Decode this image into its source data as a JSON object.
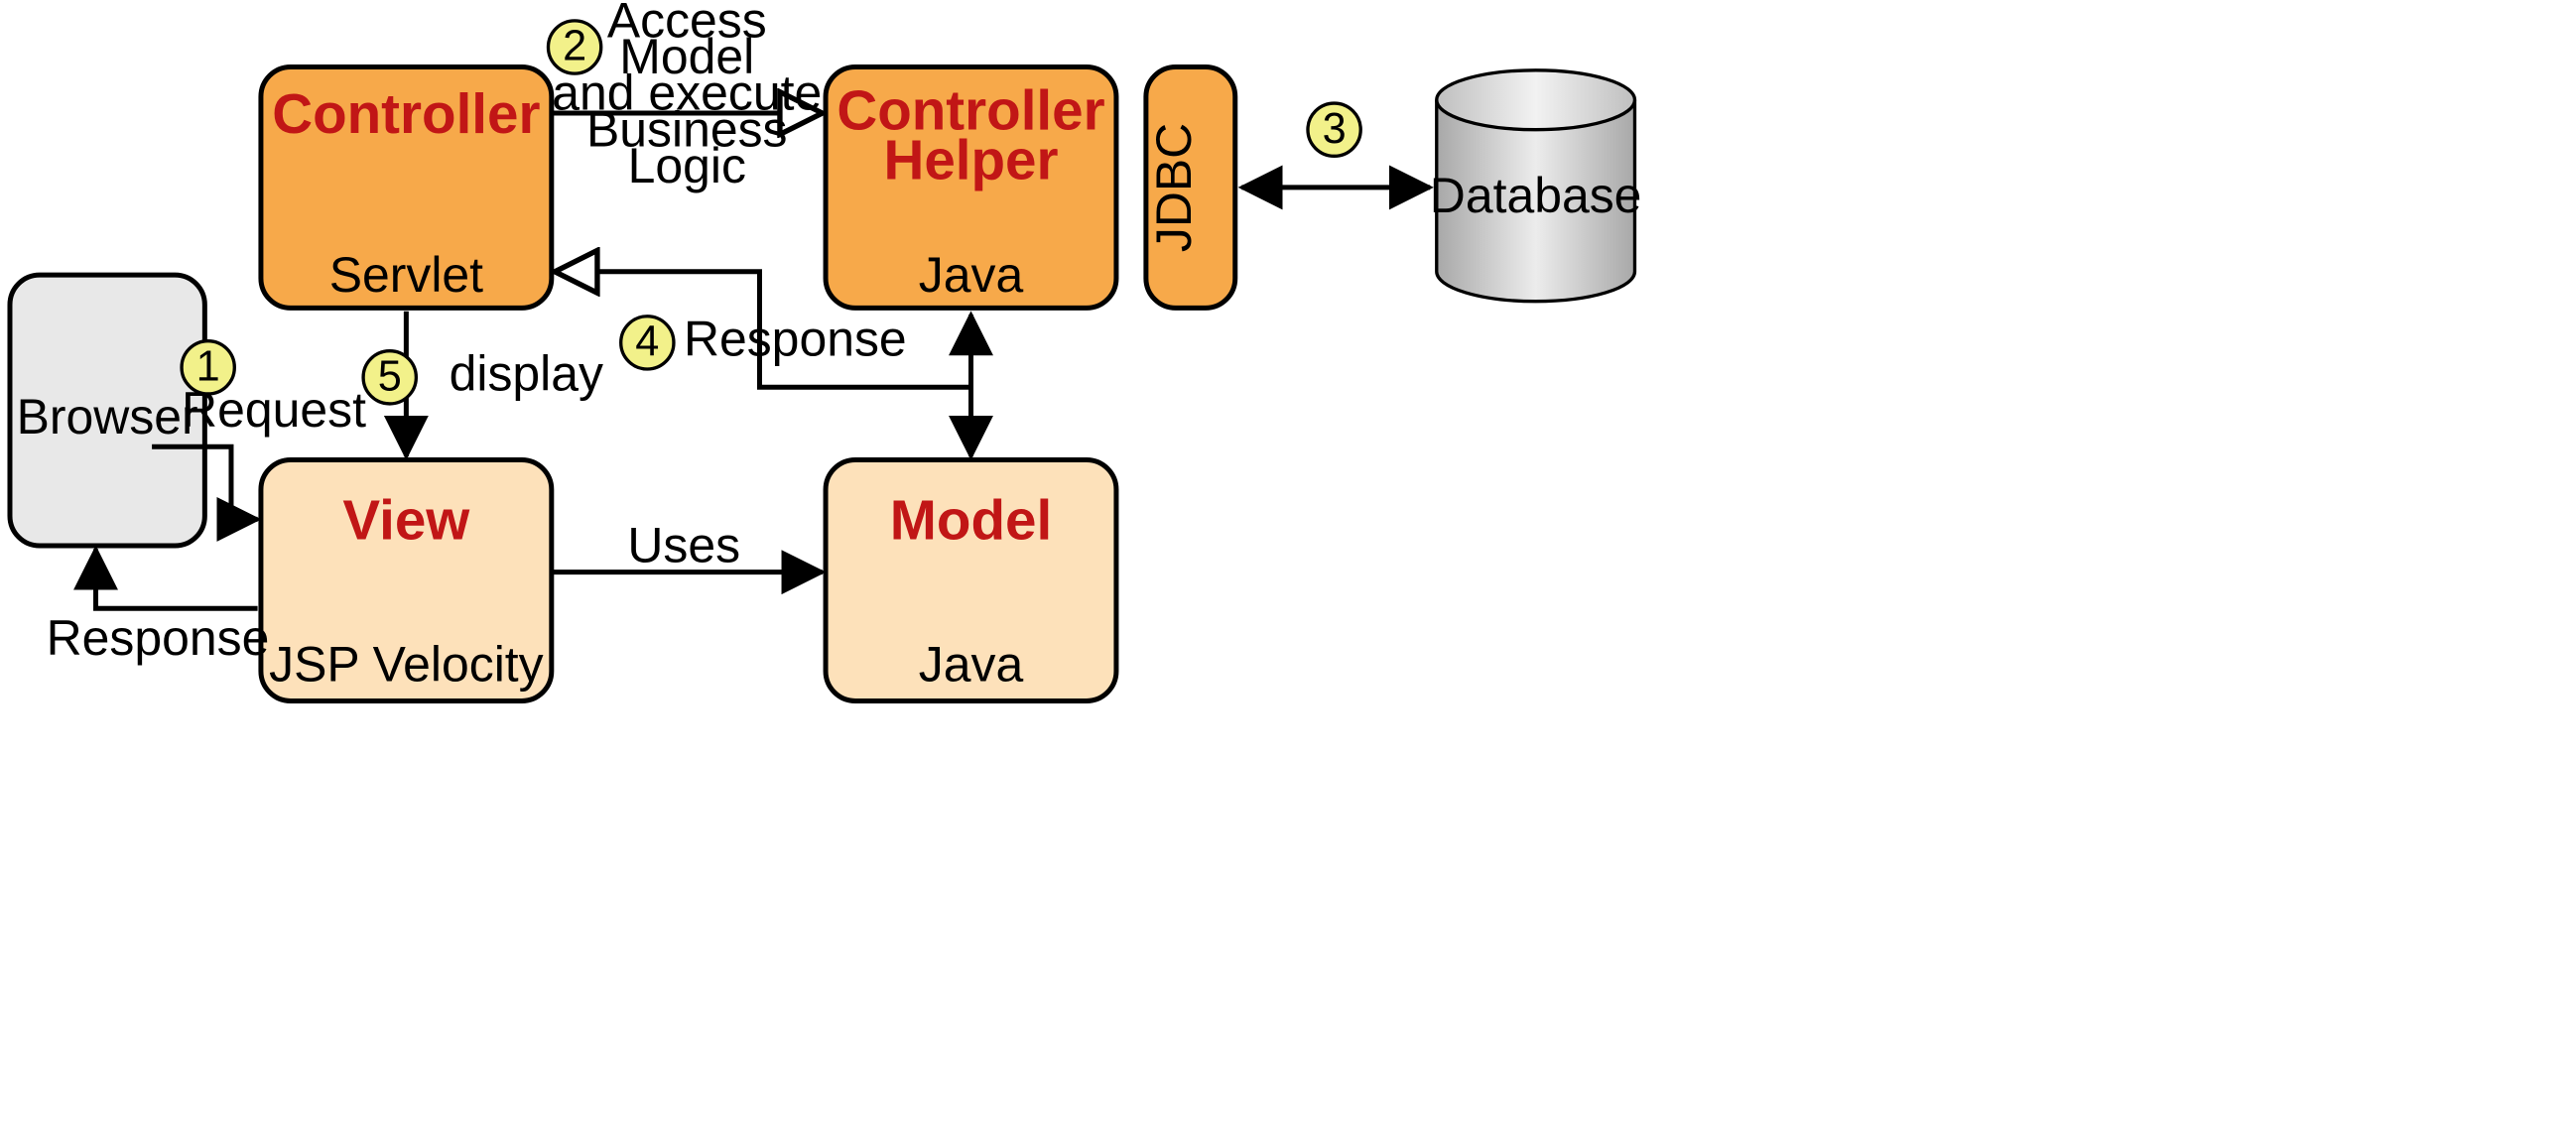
{
  "nodes": {
    "browser": {
      "label": "Browser"
    },
    "controller": {
      "title": "Controller",
      "tech": "Servlet"
    },
    "controllerHelper": {
      "title_l1": "Controller",
      "title_l2": "Helper",
      "tech": "Java"
    },
    "jdbc": {
      "label": "JDBC"
    },
    "database": {
      "label": "Database"
    },
    "view": {
      "title": "View",
      "tech": "JSP Velocity"
    },
    "model": {
      "title": "Model",
      "tech": "Java"
    }
  },
  "steps": {
    "s1": "1",
    "s2": "2",
    "s3": "3",
    "s4": "4",
    "s5": "5"
  },
  "edges": {
    "request": "Request",
    "access_l1": "Access",
    "access_l2": "Model",
    "access_l3": "and execute",
    "access_l4": "Business",
    "access_l5": "Logic",
    "responseToCtrl": "Response",
    "display": "display",
    "uses": "Uses",
    "responseToBrowser": "Response"
  }
}
